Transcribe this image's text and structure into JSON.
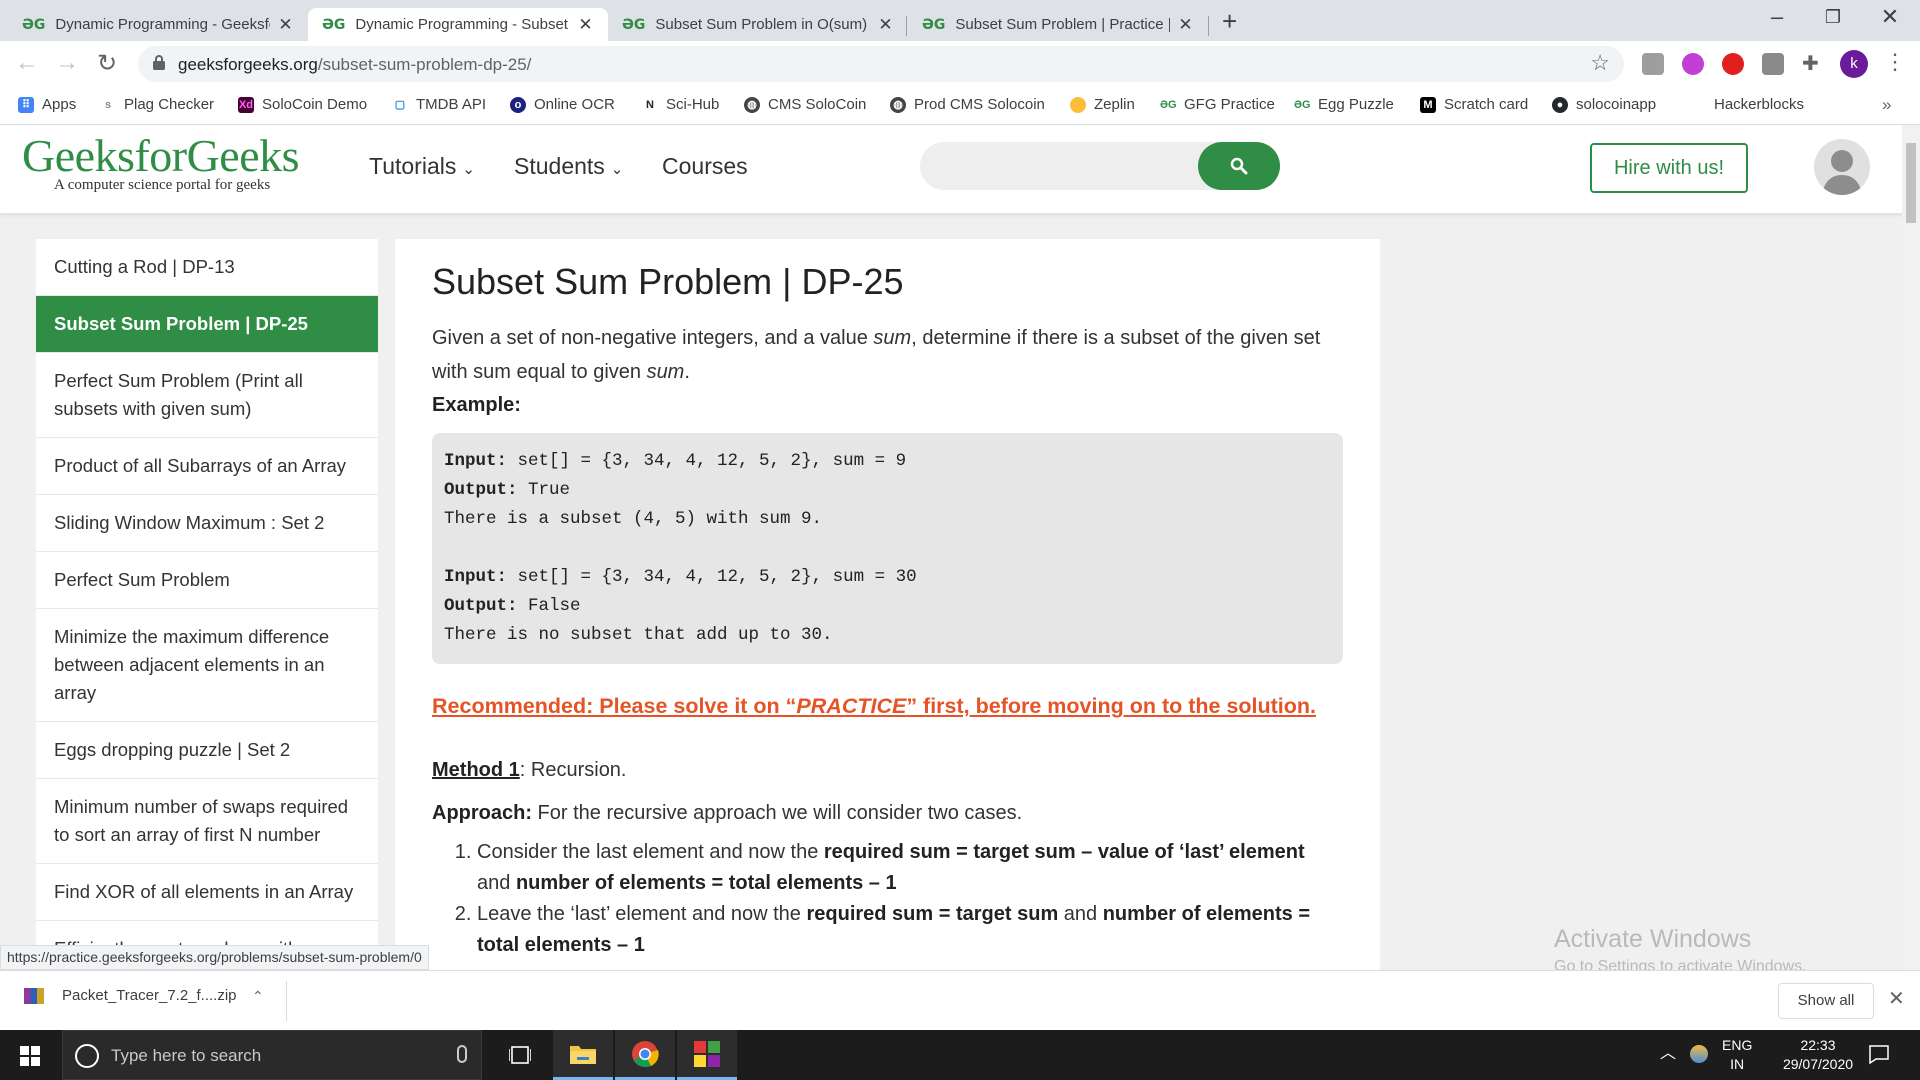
{
  "browser": {
    "tabs": [
      {
        "title": "Dynamic Programming - Geeksfo"
      },
      {
        "title": "Dynamic Programming - Subset S"
      },
      {
        "title": "Subset Sum Problem in O(sum) s"
      },
      {
        "title": "Subset Sum Problem | Practice | G"
      }
    ],
    "favicon_text": "ƏG",
    "url_domain": "geeksforgeeks.org",
    "url_path": "/subset-sum-problem-dp-25/",
    "profile_initial": "k",
    "bookmarks": [
      "Apps",
      "Plag Checker",
      "SoloCoin Demo",
      "TMDB API",
      "Online OCR",
      "Sci-Hub",
      "CMS SoloCoin",
      "Prod CMS Solocoin",
      "Zeplin",
      "GFG Practice",
      "Egg Puzzle",
      "Scratch card",
      "solocoinapp",
      "Hackerblocks"
    ],
    "status_url": "https://practice.geeksforgeeks.org/problems/subset-sum-problem/0"
  },
  "site": {
    "logo": "GeeksforGeeks",
    "tagline": "A computer science portal for geeks",
    "nav": [
      "Tutorials",
      "Students",
      "Courses"
    ],
    "hire_label": "Hire with us!",
    "brand_color": "#2f8d46"
  },
  "sidebar": {
    "items": [
      "Cutting a Rod | DP-13",
      "Subset Sum Problem | DP-25",
      "Perfect Sum Problem (Print all subsets with given sum)",
      "Product of all Subarrays of an Array",
      "Sliding Window Maximum : Set 2",
      "Perfect Sum Problem",
      "Minimize the maximum difference between adjacent elements in an array",
      "Eggs dropping puzzle | Set 2",
      "Minimum number of swaps required to sort an array of first N number",
      "Find XOR of all elements in an Array",
      "Efficiently count numbers with"
    ],
    "active_index": 1
  },
  "article": {
    "title": "Subset Sum Problem | DP-25",
    "intro_1": "Given a set of non-negative integers, and a value ",
    "intro_sum_1": "sum",
    "intro_2": ", determine if there is a subset of the given set with sum equal to given ",
    "intro_sum_2": "sum",
    "intro_3": ".",
    "example_label": "Example:",
    "code": {
      "input_label": "Input:",
      "output_label": "Output:",
      "ex1_input": " set[] = {3, 34, 4, 12, 5, 2}, sum = 9",
      "ex1_output": " True",
      "ex1_note": "There is a subset (4, 5) with sum 9.",
      "ex2_input": " set[] = {3, 34, 4, 12, 5, 2}, sum = 30",
      "ex2_output": " False",
      "ex2_note": "There is no subset that add up to 30."
    },
    "recommend_1": "Recommended: Please solve it on “",
    "recommend_practice": "PRACTICE",
    "recommend_2": "” first, before moving on to the solution.",
    "method_label": "Method 1",
    "method_text": ": Recursion.",
    "approach_label": "Approach:",
    "approach_text": " For the recursive approach we will consider two cases.",
    "step1_a": "Consider the last element and now the ",
    "step1_b": "required sum = target sum – value of ‘last’ element",
    "step1_c": " and ",
    "step1_d": "number of elements = total elements – 1",
    "step2_a": "Leave the ‘last’ element and now the ",
    "step2_b": "required sum = target sum",
    "step2_c": " and ",
    "step2_d": "number of elements = total elements – 1"
  },
  "watermark": {
    "line1": "Activate Windows",
    "line2": "Go to Settings to activate Windows."
  },
  "downloads": {
    "file": "Packet_Tracer_7.2_f....zip",
    "show_all": "Show all"
  },
  "taskbar": {
    "search_placeholder": "Type here to search",
    "lang_1": "ENG",
    "lang_2": "IN",
    "time": "22:33",
    "date": "29/07/2020"
  }
}
